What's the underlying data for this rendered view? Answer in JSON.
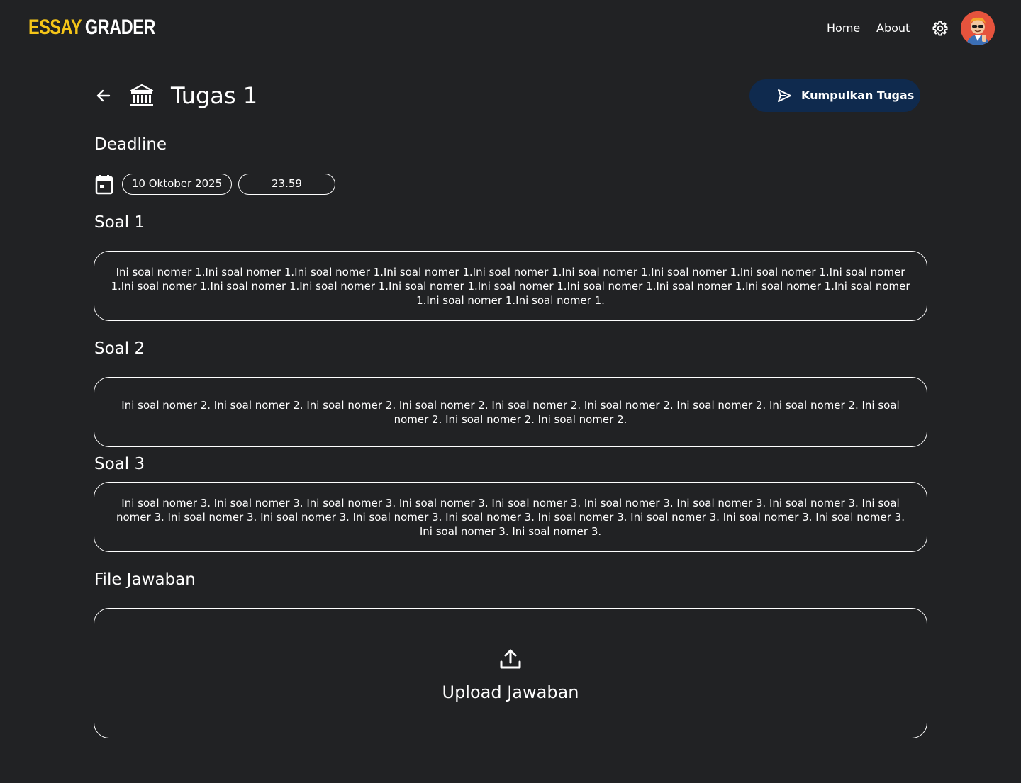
{
  "header": {
    "logo_part1": "ESSAY",
    "logo_part2": "GRADER",
    "nav": {
      "home": "Home",
      "about": "About"
    },
    "brand_color": "#f5c518"
  },
  "assignment": {
    "title": "Tugas 1",
    "submit_label": "Kumpulkan Tugas",
    "submit_color": "#0f2a4e"
  },
  "deadline": {
    "label": "Deadline",
    "date": "10 Oktober 2025",
    "time": "23.59"
  },
  "questions": [
    {
      "label": "Soal 1",
      "text": "Ini soal nomer 1.Ini soal nomer 1.Ini soal nomer 1.Ini soal nomer 1.Ini soal nomer 1.Ini soal nomer 1.Ini soal nomer 1.Ini soal nomer 1.Ini soal nomer 1.Ini soal nomer 1.Ini soal nomer 1.Ini soal nomer 1.Ini soal nomer 1.Ini soal nomer 1.Ini soal nomer 1.Ini soal nomer 1.Ini soal nomer 1.Ini soal nomer 1.Ini soal nomer 1.Ini soal nomer 1."
    },
    {
      "label": "Soal 2",
      "text": "Ini soal nomer 2. Ini soal nomer 2. Ini soal nomer 2. Ini soal nomer 2. Ini soal nomer 2. Ini soal nomer 2. Ini soal nomer 2. Ini soal nomer 2. Ini soal nomer 2. Ini soal nomer 2. Ini soal nomer 2."
    },
    {
      "label": "Soal 3",
      "text": "Ini soal nomer 3. Ini soal nomer 3. Ini soal nomer 3. Ini soal nomer 3. Ini soal nomer 3. Ini soal nomer 3. Ini soal nomer 3. Ini soal nomer 3. Ini soal nomer 3. Ini soal nomer 3. Ini soal nomer 3. Ini soal nomer 3. Ini soal nomer 3. Ini soal nomer 3. Ini soal nomer 3. Ini soal nomer 3. Ini soal nomer 3. Ini soal nomer 3. Ini soal nomer 3."
    }
  ],
  "answer": {
    "label": "File Jawaban",
    "upload_label": "Upload Jawaban"
  },
  "icons": [
    "arrow-left-icon",
    "bank-icon",
    "send-icon",
    "calendar-icon",
    "settings-gear-icon",
    "upload-icon"
  ]
}
